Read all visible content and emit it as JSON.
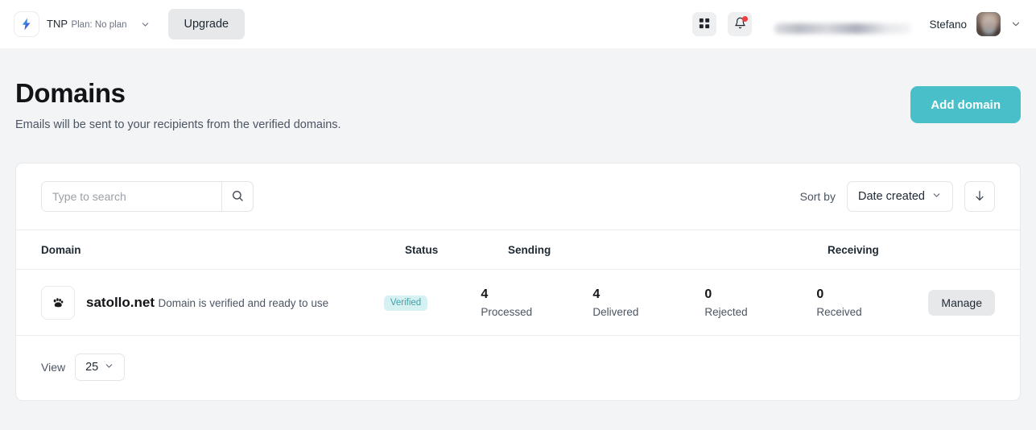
{
  "topbar": {
    "logo_icon": "bolt-logo-icon",
    "org_name": "TNP",
    "org_plan": "Plan: No plan",
    "org_caret_icon": "chevron-down-icon",
    "upgrade_label": "Upgrade",
    "apps_icon": "grid-apps-icon",
    "notifications_icon": "bell-icon",
    "notification_dot": true,
    "account_email_blurred": "",
    "user_name": "Stefano",
    "avatar_icon": "user-avatar",
    "user_caret_icon": "chevron-down-icon"
  },
  "page": {
    "title": "Domains",
    "subtitle": "Emails will be sent to your recipients from the verified domains.",
    "add_domain_label": "Add domain"
  },
  "toolbar": {
    "search_value": "",
    "search_placeholder": "Type to search",
    "search_icon": "search-icon",
    "sort_by_label": "Sort by",
    "sort_value": "Date created",
    "sort_caret_icon": "chevron-down-icon",
    "sort_order_icon": "arrow-down-icon"
  },
  "table": {
    "columns": [
      {
        "key": "domain",
        "label": "Domain"
      },
      {
        "key": "status",
        "label": "Status"
      },
      {
        "key": "sending",
        "label": "Sending"
      },
      {
        "key": "receiving",
        "label": "Receiving"
      }
    ],
    "rows": [
      {
        "favicon_icon": "paw-print-favicon",
        "name": "satollo.net",
        "description": "Domain is verified and ready to use",
        "status": "Verified",
        "stats": [
          {
            "value": "4",
            "label": "Processed"
          },
          {
            "value": "4",
            "label": "Delivered"
          },
          {
            "value": "0",
            "label": "Rejected"
          },
          {
            "value": "0",
            "label": "Received"
          }
        ],
        "action_label": "Manage"
      }
    ]
  },
  "footer": {
    "view_label": "View",
    "page_size": "25",
    "page_size_caret_icon": "chevron-down-icon"
  },
  "colors": {
    "accent": "#49bfc9",
    "badge_bg": "#d6f1f1",
    "badge_text": "#3aa3ad",
    "notification_dot": "#ef3e42",
    "page_bg": "#f3f4f6"
  }
}
